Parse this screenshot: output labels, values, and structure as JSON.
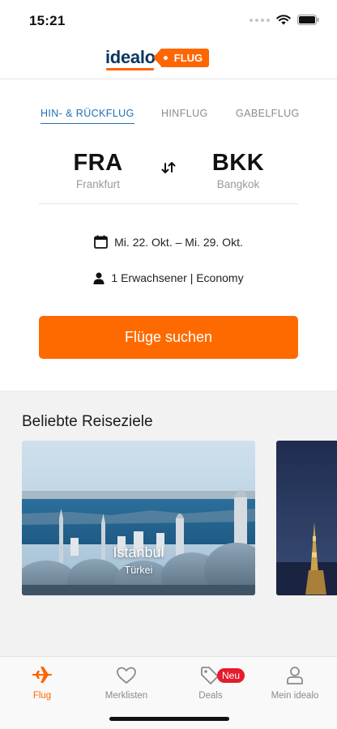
{
  "status_bar": {
    "time": "15:21"
  },
  "header": {
    "logo_text": "idealo",
    "logo_tag": "FLUG"
  },
  "search": {
    "tabs": [
      {
        "label": "HIN- & RÜCKFLUG",
        "active": true
      },
      {
        "label": "HINFLUG",
        "active": false
      },
      {
        "label": "GABELFLUG",
        "active": false
      }
    ],
    "origin": {
      "code": "FRA",
      "city": "Frankfurt"
    },
    "destination": {
      "code": "BKK",
      "city": "Bangkok"
    },
    "dates": "Mi. 22. Okt. – Mi. 29. Okt.",
    "passengers": "1 Erwachsener | Economy",
    "button_label": "Flüge suchen"
  },
  "destinations": {
    "title": "Beliebte Reiseziele",
    "cards": [
      {
        "city": "Istanbul",
        "country": "Türkei"
      },
      {
        "city": "",
        "country": ""
      }
    ]
  },
  "bottom_nav": {
    "items": [
      {
        "label": "Flug",
        "icon": "plane-icon",
        "active": true
      },
      {
        "label": "Merklisten",
        "icon": "heart-icon",
        "active": false
      },
      {
        "label": "Deals",
        "icon": "tag-icon",
        "active": false,
        "badge": "Neu"
      },
      {
        "label": "Mein idealo",
        "icon": "user-icon",
        "active": false
      }
    ]
  },
  "colors": {
    "accent": "#ff6600",
    "tab_active": "#1e6fb5",
    "badge": "#e41c2b",
    "brand_dark": "#0a3761"
  }
}
